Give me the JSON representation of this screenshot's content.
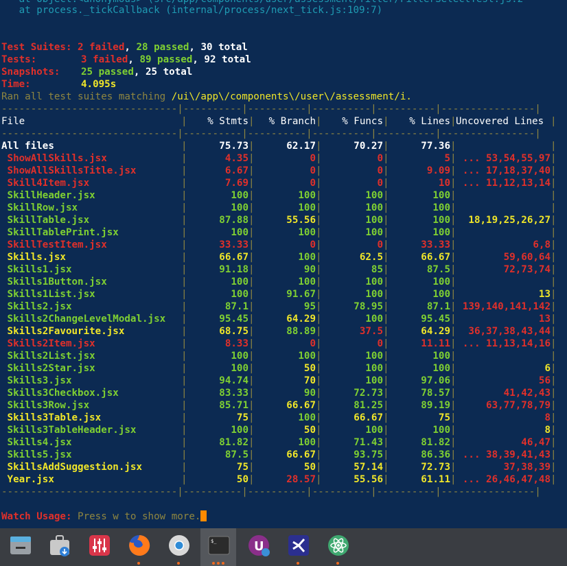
{
  "header": {
    "trace1": "   at Object.<anonymous> (src/app/components/user/assessment/filter/FilterSelectTest.js:2",
    "trace2": "   at process._tickCallback (internal/process/next_tick.js:109:7)"
  },
  "summary": {
    "suites_label": "Test Suites:",
    "suites_failed": "2 failed",
    "suites_passed": "28 passed",
    "suites_total": "30 total",
    "tests_label": "Tests:",
    "tests_failed": "3 failed",
    "tests_passed": "89 passed",
    "tests_total": "92 total",
    "snap_label": "Snapshots:",
    "snap_passed": "25 passed",
    "snap_total": "25 total",
    "time_label": "Time:",
    "time_value": "4.095s",
    "ran_text": "Ran all test suites matching ",
    "ran_pattern": "/ui\\/app\\/components\\/user\\/assessment/i."
  },
  "table": {
    "separator": "------------------------------|----------|----------|----------|----------|----------------|",
    "headers": [
      "File",
      "% Stmts",
      "% Branch",
      "% Funcs",
      "% Lines",
      "Uncovered Lines"
    ],
    "rows": [
      {
        "file": "All files",
        "stmts": "75.73",
        "branch": "62.17",
        "funcs": "70.27",
        "lines": "77.36",
        "unc": "",
        "c": [
          "wht",
          "wht",
          "wht",
          "wht",
          "wht",
          "wht"
        ]
      },
      {
        "file": "ShowAllSkills.jsx",
        "stmts": "4.35",
        "branch": "0",
        "funcs": "0",
        "lines": "5",
        "unc": "... 53,54,55,97",
        "c": [
          "red",
          "red",
          "red",
          "red",
          "red",
          "red"
        ]
      },
      {
        "file": "ShowAllSkillsTitle.jsx",
        "stmts": "6.67",
        "branch": "0",
        "funcs": "0",
        "lines": "9.09",
        "unc": "... 17,18,37,40",
        "c": [
          "red",
          "red",
          "red",
          "red",
          "red",
          "red"
        ]
      },
      {
        "file": "Skill4Item.jsx",
        "stmts": "7.69",
        "branch": "0",
        "funcs": "0",
        "lines": "10",
        "unc": "... 11,12,13,14",
        "c": [
          "red",
          "red",
          "red",
          "red",
          "red",
          "red"
        ]
      },
      {
        "file": "SkillHeader.jsx",
        "stmts": "100",
        "branch": "100",
        "funcs": "100",
        "lines": "100",
        "unc": "",
        "c": [
          "grn",
          "grn",
          "grn",
          "grn",
          "grn",
          "grn"
        ]
      },
      {
        "file": "SkillRow.jsx",
        "stmts": "100",
        "branch": "100",
        "funcs": "100",
        "lines": "100",
        "unc": "",
        "c": [
          "grn",
          "grn",
          "grn",
          "grn",
          "grn",
          "grn"
        ]
      },
      {
        "file": "SkillTable.jsx",
        "stmts": "87.88",
        "branch": "55.56",
        "funcs": "100",
        "lines": "100",
        "unc": "18,19,25,26,27",
        "c": [
          "grn",
          "grn",
          "yel",
          "grn",
          "grn",
          "yel"
        ]
      },
      {
        "file": "SkillTablePrint.jsx",
        "stmts": "100",
        "branch": "100",
        "funcs": "100",
        "lines": "100",
        "unc": "",
        "c": [
          "grn",
          "grn",
          "grn",
          "grn",
          "grn",
          "grn"
        ]
      },
      {
        "file": "SkillTestItem.jsx",
        "stmts": "33.33",
        "branch": "0",
        "funcs": "0",
        "lines": "33.33",
        "unc": "6,8",
        "c": [
          "red",
          "red",
          "red",
          "red",
          "red",
          "red"
        ]
      },
      {
        "file": "Skills.jsx",
        "stmts": "66.67",
        "branch": "100",
        "funcs": "62.5",
        "lines": "66.67",
        "unc": "59,60,64",
        "c": [
          "yel",
          "yel",
          "grn",
          "yel",
          "yel",
          "red"
        ]
      },
      {
        "file": "Skills1.jsx",
        "stmts": "91.18",
        "branch": "90",
        "funcs": "85",
        "lines": "87.5",
        "unc": "72,73,74",
        "c": [
          "grn",
          "grn",
          "grn",
          "grn",
          "grn",
          "red"
        ]
      },
      {
        "file": "Skills1Button.jsx",
        "stmts": "100",
        "branch": "100",
        "funcs": "100",
        "lines": "100",
        "unc": "",
        "c": [
          "grn",
          "grn",
          "grn",
          "grn",
          "grn",
          "grn"
        ]
      },
      {
        "file": "Skills1List.jsx",
        "stmts": "100",
        "branch": "91.67",
        "funcs": "100",
        "lines": "100",
        "unc": "13",
        "c": [
          "grn",
          "grn",
          "grn",
          "grn",
          "grn",
          "yel"
        ]
      },
      {
        "file": "Skills2.jsx",
        "stmts": "87.1",
        "branch": "95",
        "funcs": "78.95",
        "lines": "87.1",
        "unc": "139,140,141,142",
        "c": [
          "grn",
          "grn",
          "grn",
          "grn",
          "grn",
          "red"
        ]
      },
      {
        "file": "Skills2ChangeLevelModal.jsx",
        "stmts": "95.45",
        "branch": "64.29",
        "funcs": "100",
        "lines": "95.45",
        "unc": "13",
        "c": [
          "grn",
          "grn",
          "yel",
          "grn",
          "grn",
          "red"
        ]
      },
      {
        "file": "Skills2Favourite.jsx",
        "stmts": "68.75",
        "branch": "88.89",
        "funcs": "37.5",
        "lines": "64.29",
        "unc": "36,37,38,43,44",
        "c": [
          "yel",
          "yel",
          "grn",
          "red",
          "yel",
          "red"
        ]
      },
      {
        "file": "Skills2Item.jsx",
        "stmts": "8.33",
        "branch": "0",
        "funcs": "0",
        "lines": "11.11",
        "unc": "... 11,13,14,16",
        "c": [
          "red",
          "red",
          "red",
          "red",
          "red",
          "red"
        ]
      },
      {
        "file": "Skills2List.jsx",
        "stmts": "100",
        "branch": "100",
        "funcs": "100",
        "lines": "100",
        "unc": "",
        "c": [
          "grn",
          "grn",
          "grn",
          "grn",
          "grn",
          "grn"
        ]
      },
      {
        "file": "Skills2Star.jsx",
        "stmts": "100",
        "branch": "50",
        "funcs": "100",
        "lines": "100",
        "unc": "6",
        "c": [
          "grn",
          "grn",
          "yel",
          "grn",
          "grn",
          "yel"
        ]
      },
      {
        "file": "Skills3.jsx",
        "stmts": "94.74",
        "branch": "70",
        "funcs": "100",
        "lines": "97.06",
        "unc": "56",
        "c": [
          "grn",
          "grn",
          "yel",
          "grn",
          "grn",
          "red"
        ]
      },
      {
        "file": "Skills3Checkbox.jsx",
        "stmts": "83.33",
        "branch": "90",
        "funcs": "72.73",
        "lines": "78.57",
        "unc": "41,42,43",
        "c": [
          "grn",
          "grn",
          "grn",
          "grn",
          "grn",
          "red"
        ]
      },
      {
        "file": "Skills3Row.jsx",
        "stmts": "85.71",
        "branch": "66.67",
        "funcs": "81.25",
        "lines": "89.19",
        "unc": "63,77,78,79",
        "c": [
          "grn",
          "grn",
          "yel",
          "grn",
          "grn",
          "red"
        ]
      },
      {
        "file": "Skills3Table.jsx",
        "stmts": "75",
        "branch": "100",
        "funcs": "66.67",
        "lines": "75",
        "unc": "8",
        "c": [
          "yel",
          "yel",
          "grn",
          "yel",
          "yel",
          "red"
        ]
      },
      {
        "file": "Skills3TableHeader.jsx",
        "stmts": "100",
        "branch": "50",
        "funcs": "100",
        "lines": "100",
        "unc": "8",
        "c": [
          "grn",
          "grn",
          "yel",
          "grn",
          "grn",
          "yel"
        ]
      },
      {
        "file": "Skills4.jsx",
        "stmts": "81.82",
        "branch": "100",
        "funcs": "71.43",
        "lines": "81.82",
        "unc": "46,47",
        "c": [
          "grn",
          "grn",
          "grn",
          "grn",
          "grn",
          "red"
        ]
      },
      {
        "file": "Skills5.jsx",
        "stmts": "87.5",
        "branch": "66.67",
        "funcs": "93.75",
        "lines": "86.36",
        "unc": "... 38,39,41,43",
        "c": [
          "grn",
          "grn",
          "yel",
          "grn",
          "grn",
          "red"
        ]
      },
      {
        "file": "SkillsAddSuggestion.jsx",
        "stmts": "75",
        "branch": "50",
        "funcs": "57.14",
        "lines": "72.73",
        "unc": "37,38,39",
        "c": [
          "yel",
          "yel",
          "yel",
          "yel",
          "yel",
          "red"
        ]
      },
      {
        "file": "Year.jsx",
        "stmts": "50",
        "branch": "28.57",
        "funcs": "55.56",
        "lines": "61.11",
        "unc": "... 26,46,47,48",
        "c": [
          "yel",
          "yel",
          "red",
          "yel",
          "yel",
          "red"
        ]
      }
    ]
  },
  "watch": {
    "label": "Watch Usage:",
    "text": " Press w to show more."
  },
  "dock": {
    "apps": [
      {
        "name": "files",
        "label": "Files",
        "color": "#8a8f96"
      },
      {
        "name": "software",
        "label": "Software",
        "color": "#9a9a9a"
      },
      {
        "name": "mixer",
        "label": "Mixer",
        "color": "#d9364a"
      },
      {
        "name": "firefox",
        "label": "Firefox",
        "color": "#ff7a1a"
      },
      {
        "name": "chrome",
        "label": "Chrome",
        "color": "#2f8bd6"
      },
      {
        "name": "terminal",
        "label": "Terminal",
        "color": "#2b2b2b"
      },
      {
        "name": "updater",
        "label": "Updater",
        "color": "#8a2f8a"
      },
      {
        "name": "vscode",
        "label": "Visual Studio Code",
        "color": "#3a47c4"
      },
      {
        "name": "atom",
        "label": "Atom",
        "color": "#3fa870"
      }
    ]
  }
}
